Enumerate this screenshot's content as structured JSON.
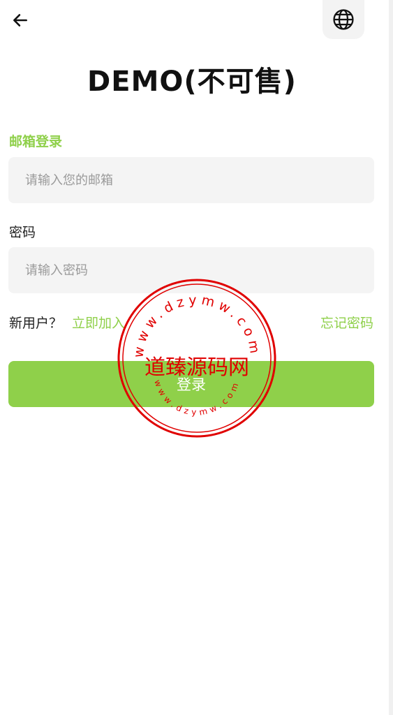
{
  "header": {
    "back_icon": "arrow-left-icon",
    "language_icon": "globe-icon"
  },
  "title": "DEMO(不可售)",
  "email_section": {
    "label": "邮箱登录",
    "placeholder": "请输入您的邮箱"
  },
  "password_section": {
    "label": "密码",
    "placeholder": "请输入密码"
  },
  "links": {
    "new_user": "新用户？",
    "join": "立即加入",
    "forgot": "忘记密码"
  },
  "login_button": "登录",
  "watermark": {
    "center": "道臻源码网",
    "ring_top": "www.dzymw.com",
    "ring_bottom": "www.dzymw.com"
  },
  "colors": {
    "accent": "#8fd04a",
    "input_bg": "#f4f4f4",
    "stamp_red": "#e00000"
  }
}
